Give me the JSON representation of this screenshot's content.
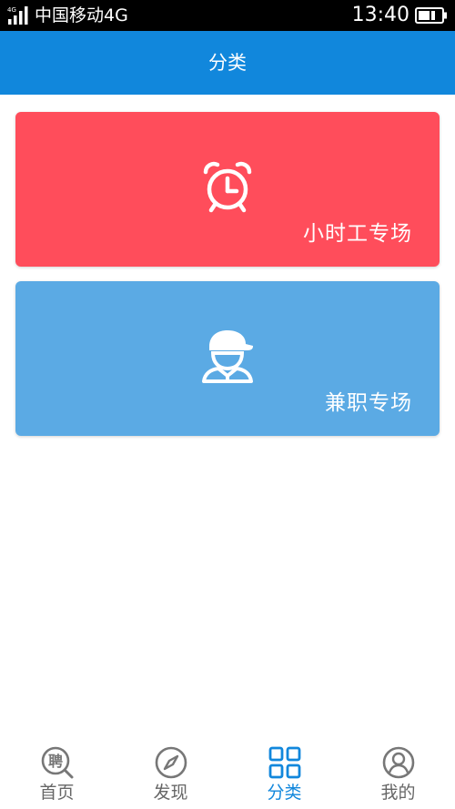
{
  "status_bar": {
    "network_badge": "4G",
    "carrier": "中国移动4G",
    "time": "13:40",
    "icons": [
      "signal-icon",
      "battery-icon"
    ]
  },
  "header": {
    "title": "分类"
  },
  "cards": [
    {
      "label": "小时工专场",
      "icon": "alarm-clock-icon",
      "color": "#ff4d5b"
    },
    {
      "label": "兼职专场",
      "icon": "worker-cap-icon",
      "color": "#5baae4"
    }
  ],
  "bottom_nav": {
    "active_color": "#1187dc",
    "inactive_color": "#777777",
    "items": [
      {
        "label": "首页",
        "icon": "hire-search-icon",
        "active": false
      },
      {
        "label": "发现",
        "icon": "compass-icon",
        "active": false
      },
      {
        "label": "分类",
        "icon": "grid-icon",
        "active": true
      },
      {
        "label": "我的",
        "icon": "user-icon",
        "active": false
      }
    ]
  },
  "colors": {
    "header": "#1187dc",
    "status_bar": "#000000",
    "background": "#ffffff"
  }
}
